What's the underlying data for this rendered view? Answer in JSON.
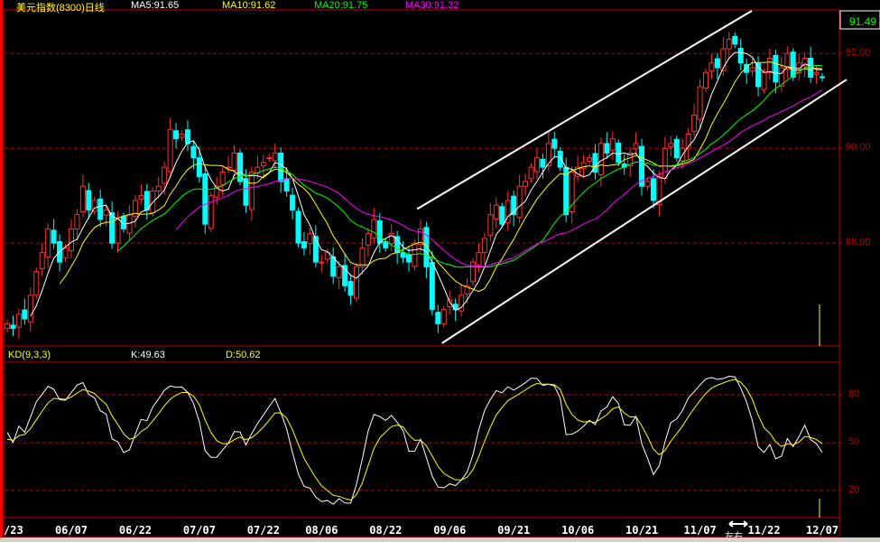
{
  "header": {
    "title": "美元指数(8300)日线",
    "ma5": "MA5:91.65",
    "ma10": "MA10:91.62",
    "ma20": "MA20:91.75",
    "ma30": "MA30:91.32",
    "last_price": "91.49"
  },
  "kd_header": {
    "title": "KD(9,3,3)",
    "k": "K:49.63",
    "d": "D:50.62"
  },
  "cursor_label": "左右",
  "colors": {
    "up": "#ff3030",
    "down": "#00ffff",
    "ma5": "#ffffff",
    "ma10": "#ffff00",
    "ma20": "#00ff00",
    "ma30": "#ff00ff",
    "grid": "#c00000",
    "k": "#ffffff",
    "d": "#ffff00"
  },
  "chart_data": [
    {
      "type": "candlestick",
      "title": "美元指数(8300)日线",
      "ylim": [
        85.83,
        92.9
      ],
      "yticks": [
        "92.00",
        "90.00",
        "88.00"
      ],
      "ytick_values": [
        92,
        90,
        88
      ],
      "xticks": [
        "/23",
        "06/07",
        "06/22",
        "07/07",
        "07/22",
        "08/06",
        "08/22",
        "09/06",
        "09/21",
        "10/06",
        "10/21",
        "11/07",
        "11/22",
        "12/07"
      ],
      "xtick_index": [
        -1,
        11,
        22,
        33,
        44,
        54,
        65,
        76,
        87,
        98,
        109,
        119,
        130,
        140
      ],
      "closes": [
        86.3,
        86.2,
        86.5,
        86.4,
        86.9,
        87.4,
        87.8,
        88.3,
        88.0,
        87.6,
        87.9,
        88.3,
        88.6,
        89.2,
        88.7,
        88.9,
        88.5,
        88.7,
        88.0,
        88.5,
        88.3,
        88.6,
        88.9,
        89.0,
        88.7,
        89.1,
        89.2,
        89.6,
        90.4,
        90.2,
        90.3,
        90.1,
        89.8,
        89.4,
        88.4,
        89.0,
        89.2,
        89.5,
        89.6,
        89.9,
        89.3,
        88.8,
        89.5,
        89.6,
        89.7,
        89.8,
        89.9,
        89.3,
        89.1,
        88.7,
        88.0,
        87.9,
        88.2,
        87.6,
        87.6,
        87.8,
        87.3,
        87.5,
        87.1,
        86.9,
        87.5,
        87.9,
        88.2,
        88.5,
        88.0,
        87.9,
        88.2,
        87.8,
        87.7,
        87.6,
        88.0,
        88.3,
        87.5,
        86.6,
        86.3,
        86.6,
        86.8,
        86.6,
        86.9,
        87.1,
        87.6,
        87.8,
        88.1,
        88.6,
        88.8,
        88.4,
        88.9,
        88.6,
        89.2,
        89.3,
        89.6,
        89.8,
        89.6,
        90.1,
        90.0,
        89.6,
        88.6,
        89.5,
        89.6,
        89.7,
        89.8,
        89.5,
        90.1,
        89.9,
        90.2,
        89.7,
        89.6,
        89.9,
        90.1,
        89.2,
        89.3,
        88.9,
        89.4,
        90.0,
        90.1,
        89.8,
        90.0,
        90.3,
        90.7,
        91.3,
        91.6,
        91.8,
        91.7,
        92.1,
        92.3,
        92.2,
        91.8,
        91.6,
        91.7,
        91.3,
        91.6,
        91.9,
        91.4,
        91.7,
        92.0,
        91.5,
        91.8,
        91.9,
        91.5,
        91.6,
        91.49
      ],
      "moving_averages": [
        5,
        10,
        20,
        30
      ],
      "trend_lines": [
        {
          "name": "upper-channel",
          "from": [
            70.4,
            88.72
          ],
          "to": [
            127.9,
            92.9
          ]
        },
        {
          "name": "lower-channel",
          "from": [
            74.7,
            85.89
          ],
          "to": [
            144.2,
            91.45
          ]
        }
      ]
    },
    {
      "type": "line",
      "title": "KD(9,3,3)",
      "ylim": [
        0,
        100
      ],
      "yticks": [
        "80",
        "50",
        "20"
      ],
      "ytick_values": [
        80,
        50,
        20
      ],
      "series": [
        {
          "name": "K"
        },
        {
          "name": "D"
        }
      ]
    }
  ]
}
